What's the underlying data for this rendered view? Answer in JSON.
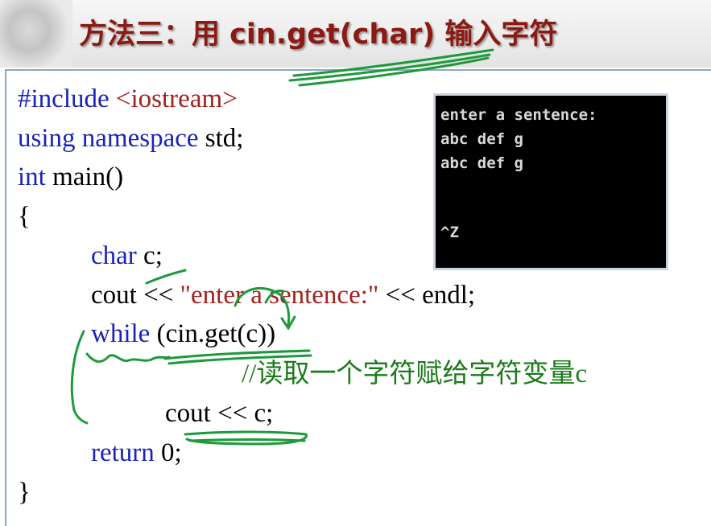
{
  "title": "方法三：用 cin.get(char) 输入字符",
  "code": {
    "l1_directive": "#include",
    "l1_header": " <iostream>",
    "l2_kw": "using namespace",
    "l2_rest": " std;",
    "l3_kw": "int",
    "l3_rest": " main()",
    "l4": "{",
    "l5_kw": "char",
    "l5_rest": " c;",
    "l6_a": "cout << ",
    "l6_str": "\"enter a sentence:\"",
    "l6_b": " << endl;",
    "l7_kw": "while",
    "l7_rest": " (cin.get(c))",
    "l8_comment": "//读取一个字符赋给字符变量c",
    "l9": "cout << c;",
    "l10_kw": "return",
    "l10_rest": " 0;",
    "l11": "}"
  },
  "console": {
    "lines": [
      "enter a sentence:",
      "abc def g",
      "abc def g",
      "",
      "^Z"
    ]
  },
  "colors": {
    "title": "#8b1a12",
    "keyword": "#1a23b8",
    "string": "#a4211b",
    "comment": "#1b7a1b",
    "annotation": "#1e9a3c"
  }
}
